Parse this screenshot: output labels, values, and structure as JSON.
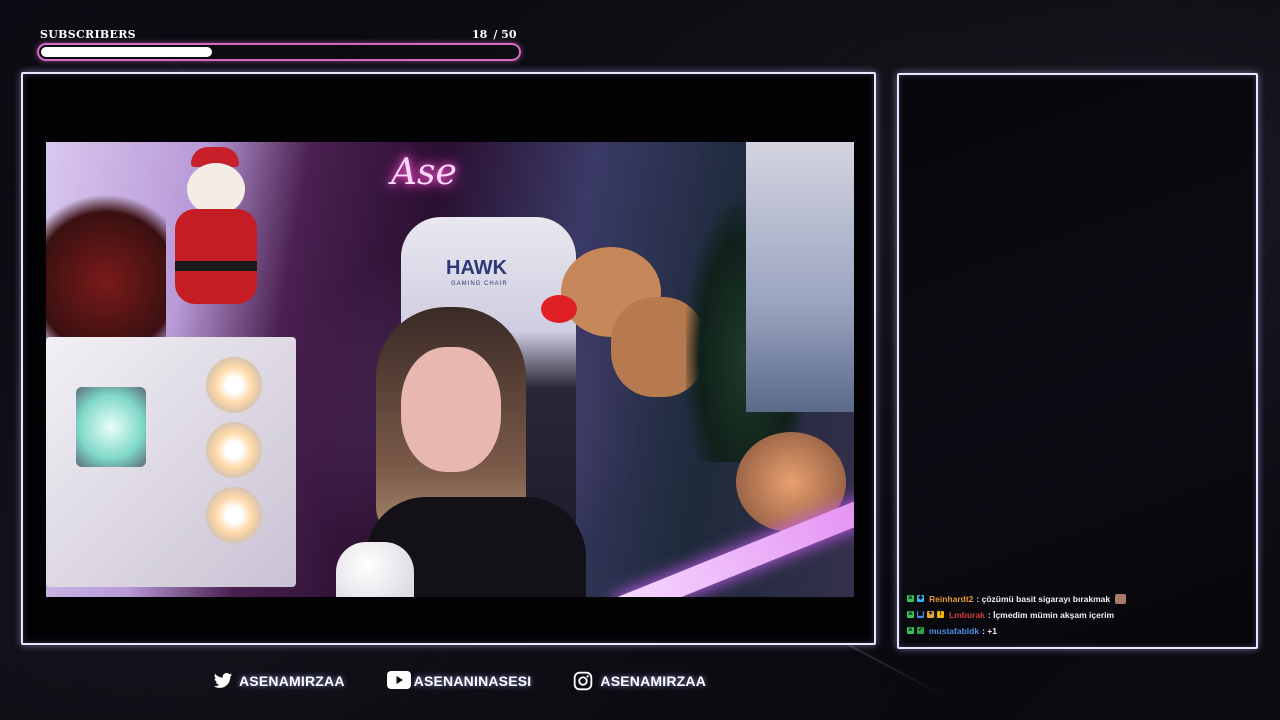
{
  "subscriber_goal": {
    "label": "SUBSCRIBERS",
    "current": "18",
    "target": "/ 50",
    "progress_fraction": 0.36,
    "bar_color": "#d66ac6"
  },
  "camera": {
    "frame_color": "#e8e6ff",
    "scene_text": {
      "chair_brand": "HAWK",
      "chair_sub": "GAMING CHAIR",
      "neon_sign": "Ase"
    }
  },
  "chat": {
    "messages": [
      {
        "badges": [
          "moderator-badge",
          "gem-badge"
        ],
        "user": "Reinhardt2",
        "user_color": "#e59a3c",
        "text": ": çözümü basit sigarayı bırakmak",
        "emote": "cat-emote"
      },
      {
        "badges": [
          "moderator-badge",
          "game-badge",
          "gift-badge",
          "warning-badge"
        ],
        "user": "Lmburak",
        "user_color": "#d23a3a",
        "text": ": İçmedim mümin akşam içerim",
        "emote": null
      },
      {
        "badges": [
          "moderator-badge",
          "sword-badge"
        ],
        "user": "mustafabldk",
        "user_color": "#4a8de0",
        "text": ": +1",
        "emote": null
      }
    ]
  },
  "socials": [
    {
      "icon": "twitter-icon",
      "handle": "ASENAMIRZAA"
    },
    {
      "icon": "youtube-icon",
      "handle": "ASENANINASESI"
    },
    {
      "icon": "instagram-icon",
      "handle": "ASENAMIRZAA"
    }
  ]
}
